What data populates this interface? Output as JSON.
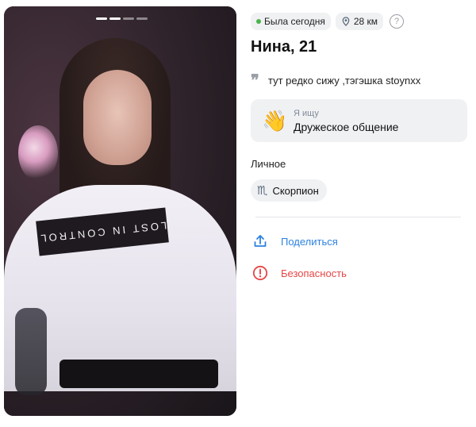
{
  "photo": {
    "indicators": [
      true,
      true,
      false,
      false
    ],
    "shirt_print": "LOST IN CONTROL"
  },
  "profile": {
    "status": "Была сегодня",
    "distance": "28 км",
    "help": "?",
    "name_age": "Нина, 21",
    "bio": "тут редко сижу ,тэгэшка stoynxx",
    "looking_label": "Я ищу",
    "looking_value": "Дружеское общение",
    "personal_label": "Личное",
    "zodiac_symbol": "♏",
    "zodiac": "Скорпион"
  },
  "actions": {
    "share": "Поделиться",
    "safety": "Безопасность"
  },
  "colors": {
    "online": "#4bb34b",
    "link": "#2d81e0",
    "danger": "#e64646",
    "chip_bg": "#f0f1f3"
  },
  "icons": {
    "location": "map-pin-icon",
    "help": "question-circle-icon",
    "quote": "quote-icon",
    "looking": "waving-hand-icon",
    "share": "share-upload-icon",
    "safety": "alert-circle-icon"
  }
}
